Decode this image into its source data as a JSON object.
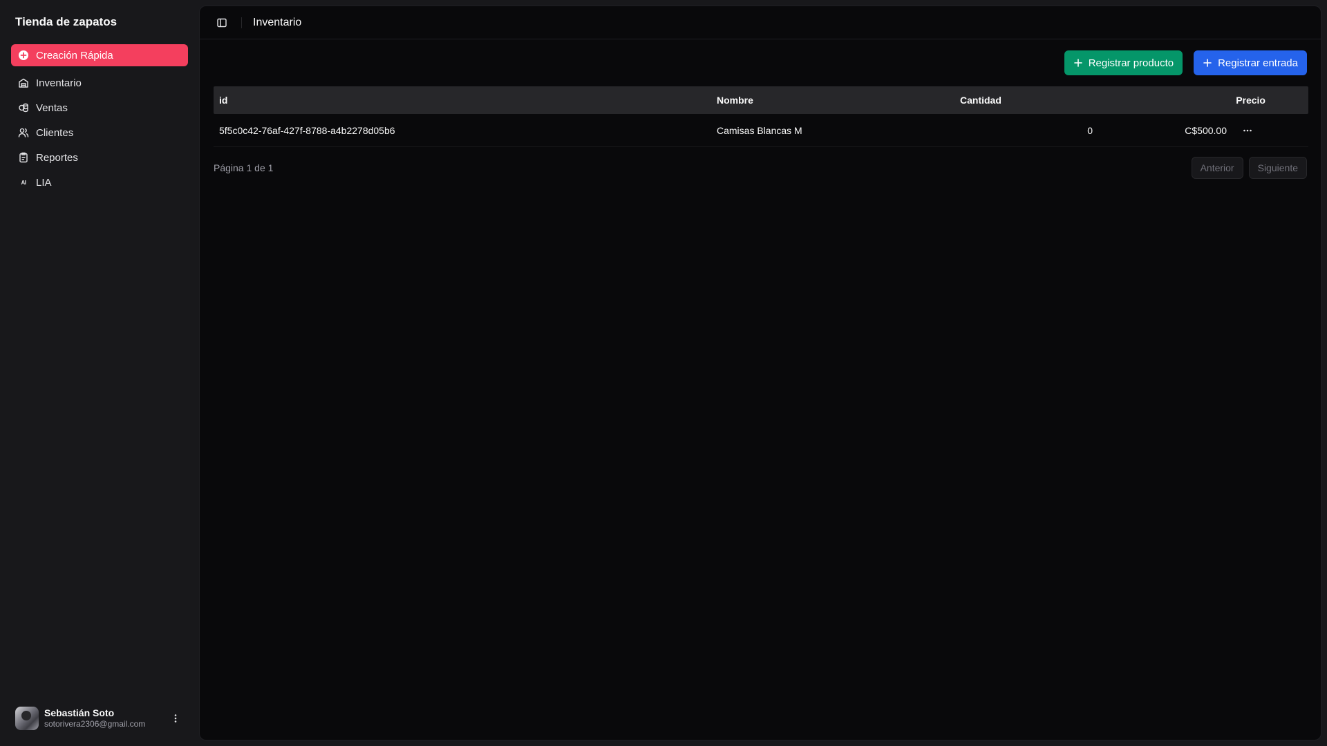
{
  "sidebar": {
    "brand": "Tienda de zapatos",
    "quick_create": "Creación Rápida",
    "items": [
      {
        "label": "Inventario",
        "icon": "warehouse-icon"
      },
      {
        "label": "Ventas",
        "icon": "coins-icon"
      },
      {
        "label": "Clientes",
        "icon": "users-icon"
      },
      {
        "label": "Reportes",
        "icon": "clipboard-icon"
      },
      {
        "label": "LIA",
        "icon": "ai-icon",
        "badge": "AI"
      }
    ],
    "user": {
      "name": "Sebastián Soto",
      "email": "sotorivera2306@gmail.com"
    }
  },
  "header": {
    "title": "Inventario"
  },
  "toolbar": {
    "register_product": "Registrar producto",
    "register_entry": "Registrar entrada"
  },
  "table": {
    "columns": [
      "id",
      "Nombre",
      "Cantidad",
      "Precio"
    ],
    "rows": [
      {
        "id": "5f5c0c42-76af-427f-8788-a4b2278d05b6",
        "name": "Camisas Blancas M",
        "qty": "0",
        "price": "C$500.00"
      }
    ]
  },
  "pagination": {
    "info": "Página 1 de 1",
    "prev": "Anterior",
    "next": "Siguiente"
  },
  "colors": {
    "accent": "#f43f5e",
    "green": "#059669",
    "blue": "#2563eb"
  }
}
